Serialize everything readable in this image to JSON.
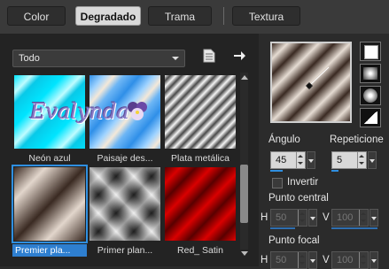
{
  "tabs": [
    {
      "label": "Color",
      "active": false
    },
    {
      "label": "Degradado",
      "active": true
    },
    {
      "label": "Trama",
      "active": false
    },
    {
      "label": "Textura",
      "active": false
    }
  ],
  "gradient_dropdown": {
    "value": "Todo"
  },
  "thumbnails": [
    {
      "label": "Neón azul",
      "selected": false
    },
    {
      "label": "Paisaje des...",
      "selected": false
    },
    {
      "label": "Plata metálica",
      "selected": false
    },
    {
      "label": "Premier pla...",
      "selected": true
    },
    {
      "label": "Primer plan...",
      "selected": false
    },
    {
      "label": "Red_ Satin",
      "selected": false
    }
  ],
  "watermark_text": "Evalynda",
  "angle": {
    "label": "Ángulo",
    "value": "45"
  },
  "repeats": {
    "label": "Repeticione",
    "value": "5"
  },
  "invert_label": "Invertir",
  "center_point": {
    "label": "Punto central",
    "h_label": "H",
    "h_value": "50",
    "v_label": "V",
    "v_value": "100"
  },
  "focal_point": {
    "label": "Punto focal",
    "h_label": "H",
    "h_value": "50",
    "v_label": "V",
    "v_value": "100"
  },
  "colors": {
    "accent": "#2f8fe0",
    "panel": "#232323",
    "tabbar": "#3a3a3a"
  }
}
